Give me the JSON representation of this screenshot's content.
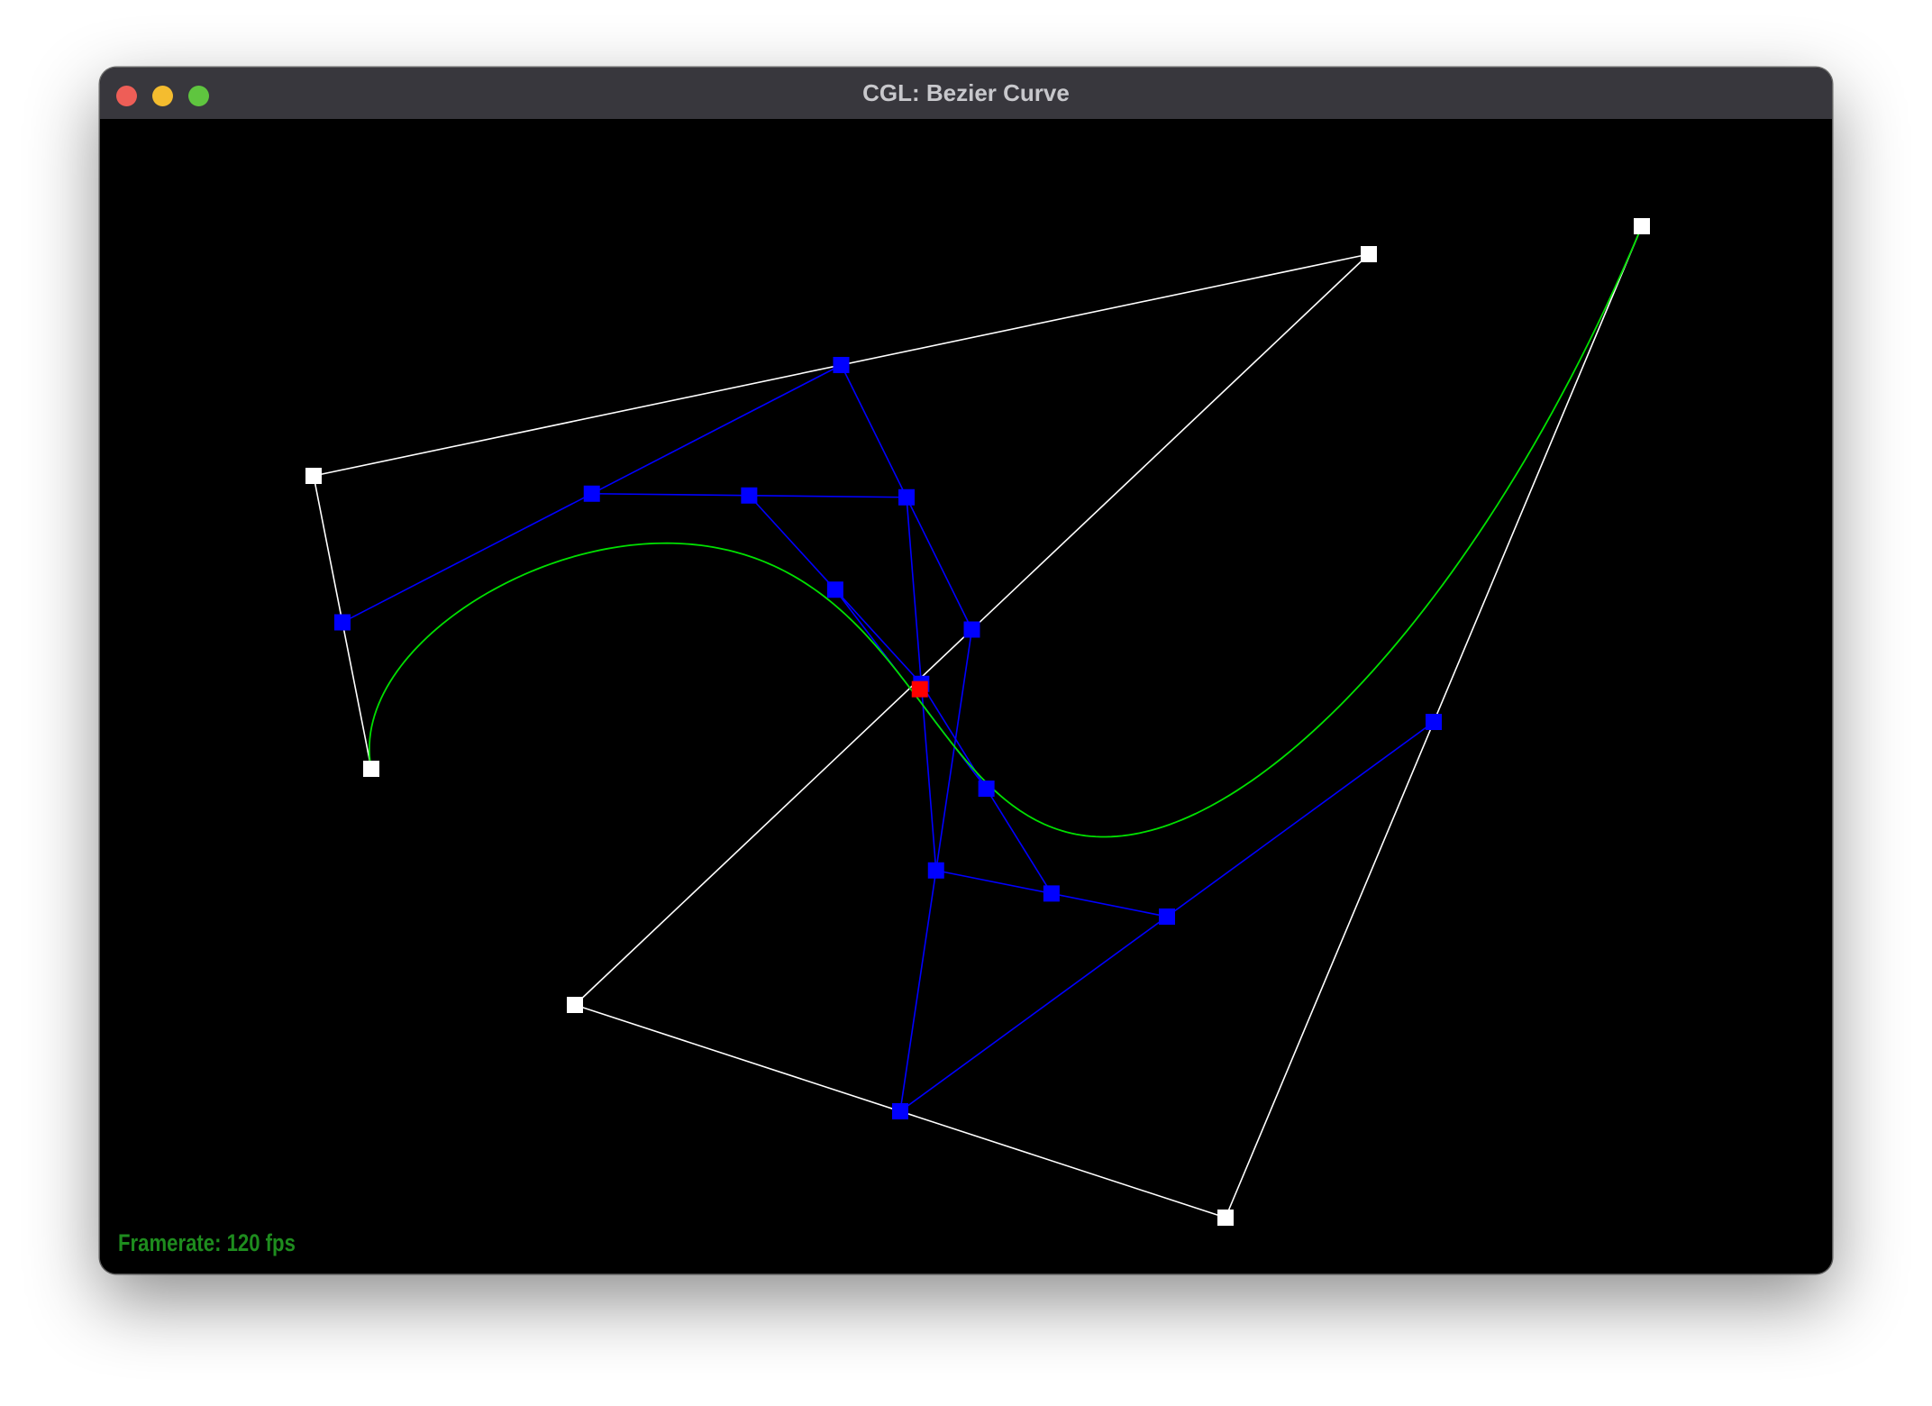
{
  "window": {
    "title": "CGL: Bezier Curve",
    "buttons": {
      "close_color": "#ee5e57",
      "minimize_color": "#f4bc2f",
      "maximize_color": "#5fc53f"
    }
  },
  "hud": {
    "framerate_label": "Framerate: 120 fps",
    "framerate_color": "#1e8c1e"
  },
  "scene": {
    "background_color": "#000000",
    "curve_color": "#00e000",
    "control_color": "#ffffff",
    "construction_color": "#0000ff",
    "evaluated_point_color": "#ff0000",
    "curve_parameter_t": 0.5
  }
}
